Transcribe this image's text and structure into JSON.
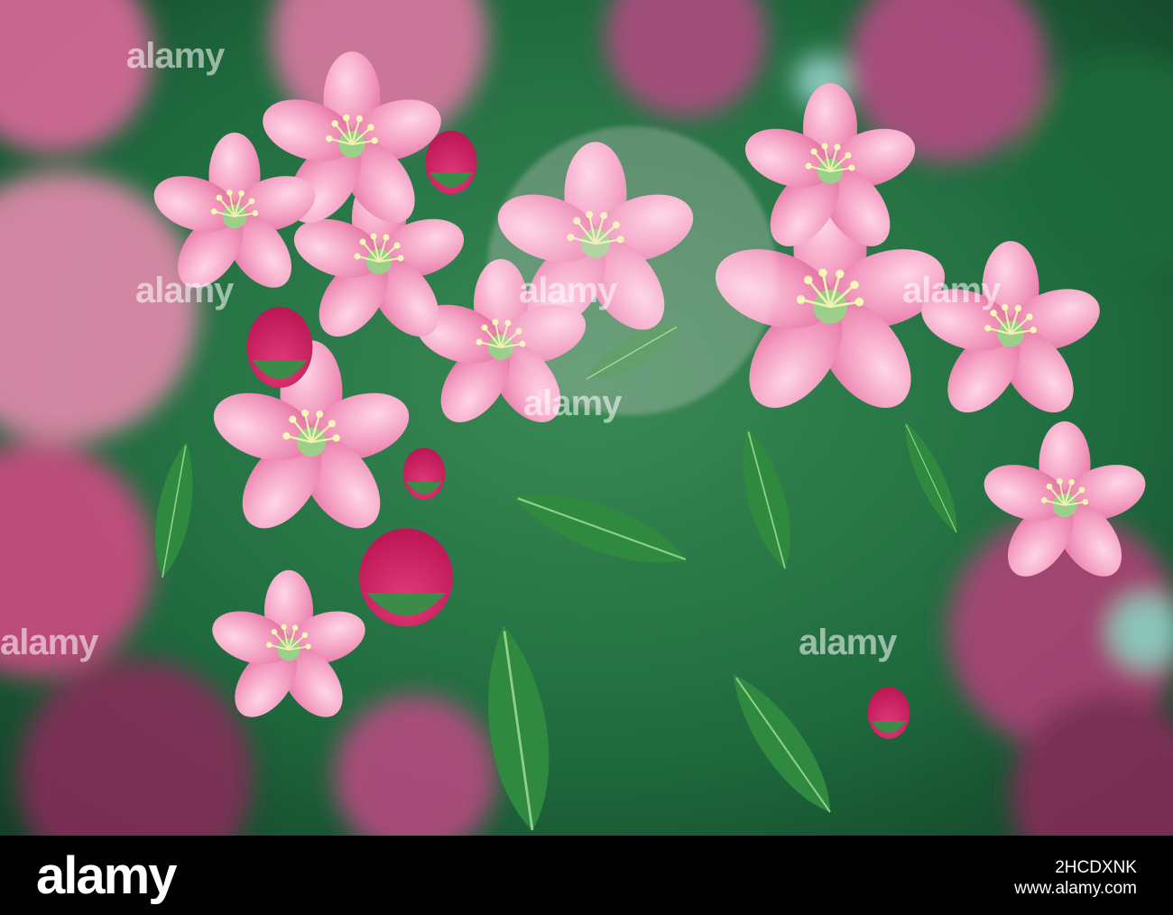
{
  "watermark": {
    "brand": "alamy",
    "image_id": "2HCDXNK",
    "url": "www.alamy.com",
    "tile_text": "alamy"
  },
  "photo": {
    "subject": "pink crabapple blossoms with green leaves",
    "colors": {
      "background_green": "#1f6b3e",
      "blossom_pink": "#f08cb4",
      "blossom_deep": "#c8185a",
      "leaf_green": "#2f8a3f",
      "stamen_yellow": "#e8f0a0"
    }
  }
}
